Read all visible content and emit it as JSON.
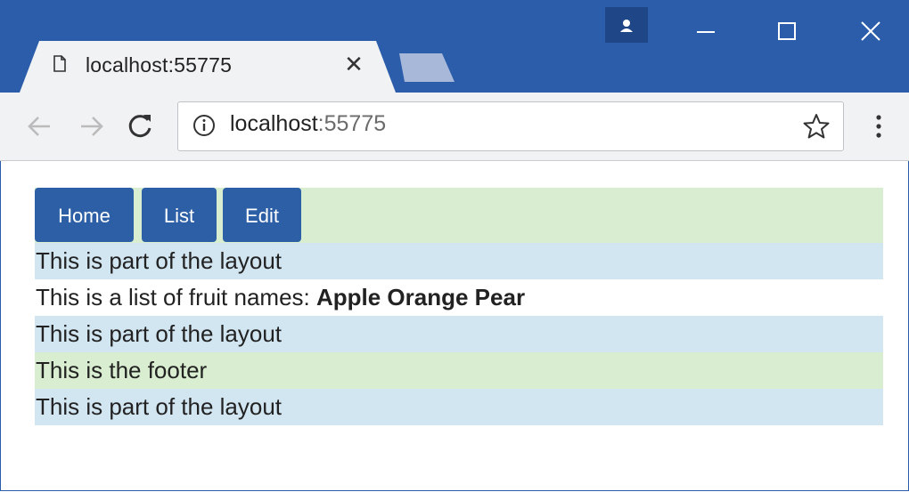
{
  "browser": {
    "tab_title": "localhost:55775",
    "url_host": "localhost",
    "url_port": ":55775",
    "icons": [
      "doc-icon",
      "close-icon",
      "profile-icon",
      "minimize-icon",
      "maximize-icon",
      "close-window-icon",
      "back-icon",
      "forward-icon",
      "reload-icon",
      "info-icon",
      "star-icon",
      "menu-icon"
    ]
  },
  "nav": {
    "home_label": "Home",
    "list_label": "List",
    "edit_label": "Edit"
  },
  "page": {
    "layout_text_1": "This is part of the layout",
    "list_prefix": "This is a list of fruit names: ",
    "fruits": "Apple Orange Pear",
    "layout_text_2": "This is part of the layout",
    "footer_text": "This is the footer",
    "layout_text_3": "This is part of the layout"
  },
  "colors": {
    "titlebar": "#2b5dab",
    "button": "#2c5fa5",
    "green_row": "#d9eed0",
    "blue_row": "#d2e6f2"
  }
}
